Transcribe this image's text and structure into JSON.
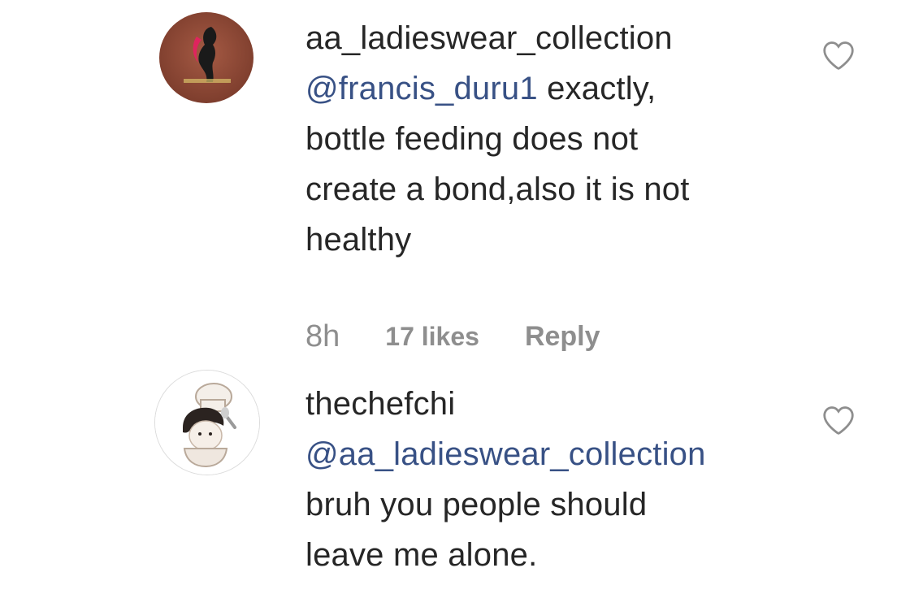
{
  "comments": [
    {
      "username": "aa_ladieswear_collection",
      "mention": "@francis_duru1",
      "lines": [
        "exactly,",
        "bottle feeding does not",
        "create a bond,also it is not",
        "healthy"
      ],
      "time": "8h",
      "likes": "17 likes",
      "reply": "Reply",
      "avatar_icon": "brand-logo-avatar",
      "like_icon": "heart-outline-icon"
    },
    {
      "username": "thechefchi",
      "mention": "@aa_ladieswear_collection",
      "lines": [
        "bruh you people should",
        "leave me alone."
      ],
      "avatar_icon": "chef-avatar",
      "like_icon": "heart-outline-icon"
    }
  ],
  "colors": {
    "text": "#262626",
    "mention": "#385185",
    "meta": "#8e8e8e",
    "heart_stroke": "#8e8e8e"
  }
}
